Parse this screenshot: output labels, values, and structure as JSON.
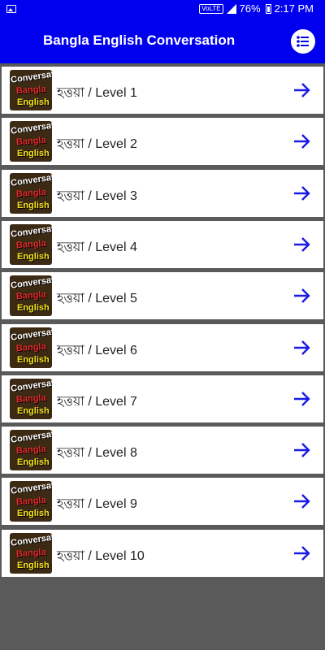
{
  "status_bar": {
    "network_label": "VoLTE",
    "battery": "76%",
    "time": "2:17 PM"
  },
  "app_bar": {
    "title": "Bangla English Conversation",
    "menu_icon": "list-icon"
  },
  "thumbnail": {
    "line1": "Conversation",
    "line2": "Bangla",
    "line3": "English"
  },
  "levels": [
    {
      "label": "হত্তয়া / Level 1"
    },
    {
      "label": "হত্তয়া / Level 2"
    },
    {
      "label": "হত্তয়া / Level 3"
    },
    {
      "label": "হত্তয়া / Level 4"
    },
    {
      "label": "হত্তয়া / Level 5"
    },
    {
      "label": "হত্তয়া / Level 6"
    },
    {
      "label": "হত্তয়া / Level 7"
    },
    {
      "label": "হত্তয়া / Level 8"
    },
    {
      "label": "হত্তয়া / Level 9"
    },
    {
      "label": "হত্তয়া / Level 10"
    }
  ],
  "colors": {
    "primary": "#0000ee",
    "background": "#5a5a5a",
    "arrow": "#1a1ae6"
  }
}
